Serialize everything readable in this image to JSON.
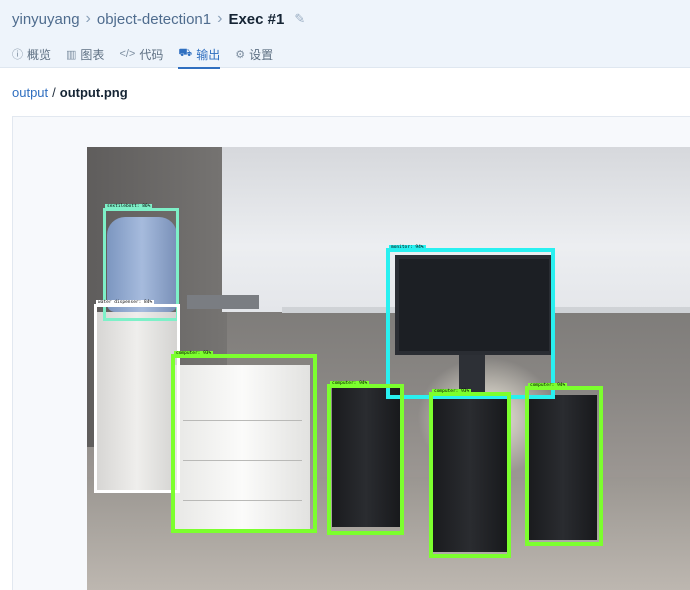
{
  "breadcrumb": {
    "user": "yinyuyang",
    "project": "object-detection1",
    "current": "Exec #1"
  },
  "tabs": [
    {
      "label": "概览",
      "icon": "info-circle-icon",
      "active": false
    },
    {
      "label": "图表",
      "icon": "bar-chart-icon",
      "active": false
    },
    {
      "label": "代码",
      "icon": "code-icon",
      "active": false
    },
    {
      "label": "输出",
      "icon": "truck-icon",
      "active": true
    },
    {
      "label": "设置",
      "icon": "gear-icon",
      "active": false
    }
  ],
  "output_path": {
    "folder": "output",
    "separator": "/",
    "file": "output.png"
  },
  "detections": [
    {
      "label": "sextilebott: 86%",
      "color": "#7ef0c8"
    },
    {
      "label": "water dispenser: 84%",
      "color": "#ffffff"
    },
    {
      "label": "computer: 93%",
      "color": "#7cff2e"
    },
    {
      "label": "monitor: 94%",
      "color": "#29f0f0"
    },
    {
      "label": "computer: 94%",
      "color": "#7cff2e"
    },
    {
      "label": "computer: 93%",
      "color": "#7cff2e"
    },
    {
      "label": "computer: 94%",
      "color": "#7cff2e"
    }
  ]
}
